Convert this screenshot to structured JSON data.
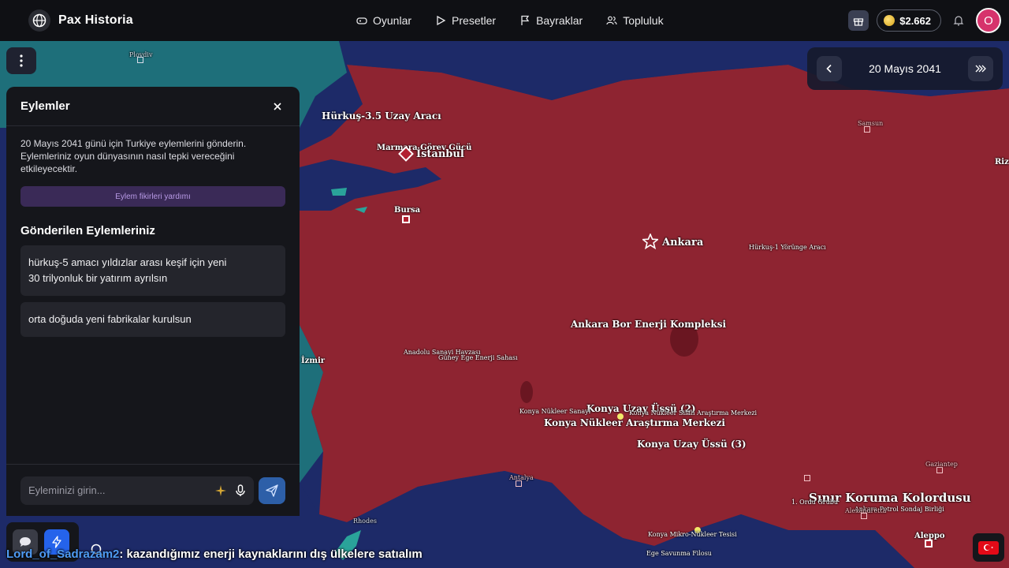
{
  "app": {
    "brand": "Pax Historia",
    "nav": [
      "Oyunlar",
      "Presetler",
      "Bayraklar",
      "Topluluk"
    ],
    "coins": "$2.662",
    "avatar_initial": "O"
  },
  "date_nav": {
    "date": "20 Mayıs 2041"
  },
  "panel": {
    "title": "Eylemler",
    "description": "20 Mayıs 2041 günü için Turkiye eylemlerini gönderin. Eylemleriniz oyun dünyasının nasıl tepki vereceğini etkileyecektir.",
    "help_button": "Eylem fikirleri yardımı",
    "sent_title": "Gönderilen Eylemleriniz",
    "sent_actions": [
      "hürkuş-5 amacı yıldızlar arası keşif için yeni 30 trilyonluk bir yatırım ayrılsın",
      "orta doğuda yeni fabrikalar kurulsun"
    ],
    "input_placeholder": "Eyleminizi girin..."
  },
  "chat": {
    "user": "Lord_of_Sadrazam2",
    "message": ": kazandığımız enerji kaynaklarını dış ülkelere satıalım"
  },
  "map": {
    "labels": {
      "hurkus35": "Hürkuş-3.5 Uzay Aracı",
      "marmara": "Marmara Görev Gücü",
      "istanbul": "İstanbul",
      "bursa": "Bursa",
      "ankara": "Ankara",
      "hurkus1": "Hürkuş-1 Yörünge Aracı",
      "bor": "Ankara Bor Enerji Kompleksi",
      "anadolu": "Anadolu Sanayi Havzası",
      "guney_ege": "Güney Ege Enerji Sahası",
      "konya_uzay2": "Konya Uzay Üssü (2)",
      "konya_nuk_sanayi": "Konya Nükleer Sanayi",
      "konya_silah": "Konya Nükleer Silah Araştırma Merkezi",
      "konya_arastirma": "Konya Nükleer Araştırma Merkezi",
      "konya_uzay3": "Konya Uzay Üssü (3)",
      "sinir": "Sınır Koruma Kolordusu",
      "ordu": "1. Ordu Grubu",
      "antalya": "Antalya",
      "konya_mikro": "Konya Mikro-Nükleer Tesisi",
      "ege_savunma": "Ege Savunma Filosu",
      "rhodes": "Rhodes",
      "aleppo": "Aleppo",
      "alexandria": "Alexandretta",
      "gaziantep": "Gaziantep",
      "ankara_petrol": "Ankara Petrol Sondaj Birliği",
      "plovdiv": "Plovdiv",
      "samsun": "Samsun",
      "riz": "Riz",
      "izmir": "İzmir"
    }
  },
  "colors": {
    "turkey": "#8e2431",
    "sea": "#1d2a68",
    "land_other": "#1e6f7a",
    "accent": "#2563eb"
  }
}
